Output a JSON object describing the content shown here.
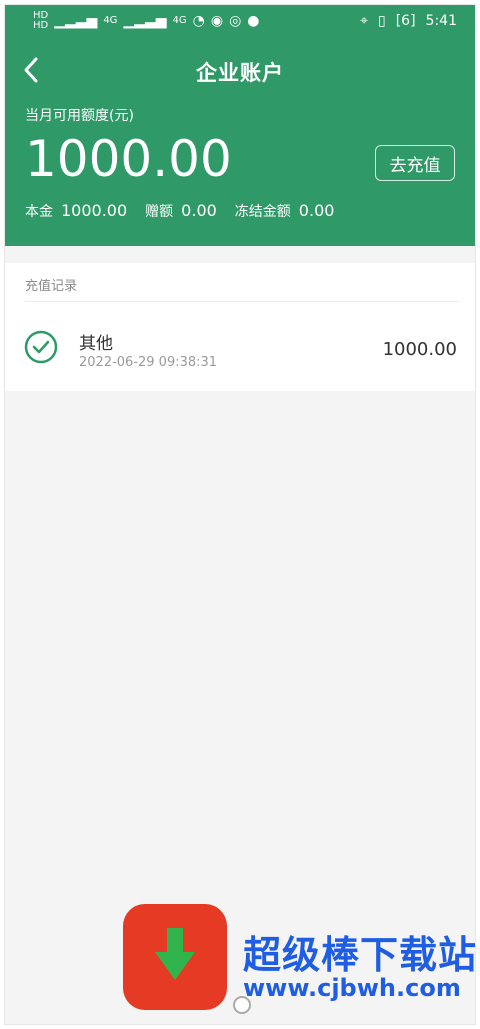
{
  "status_bar": {
    "left_small_1": "HD",
    "left_small_2": "HD",
    "signal_1": "4G",
    "signal_2": "4G",
    "time": "5:41",
    "battery": "6"
  },
  "header": {
    "title": "企业账户",
    "limit_label": "当月可用额度(元)",
    "amount": "1000.00",
    "recharge_button": "去充值",
    "summary": [
      {
        "label": "本金",
        "value": "1000.00"
      },
      {
        "label": "赠额",
        "value": "0.00"
      },
      {
        "label": "冻结金额",
        "value": "0.00"
      }
    ]
  },
  "records": {
    "section_title": "充值记录",
    "items": [
      {
        "name": "其他",
        "time": "2022-06-29 09:38:31",
        "amount": "1000.00"
      }
    ]
  },
  "watermark": {
    "text": "超级棒下载站",
    "url": "www.cjbwh.com"
  },
  "colors": {
    "primary": "#2f9a68",
    "watermark_blue": "#1f5de2",
    "watermark_red": "#e53b24"
  }
}
